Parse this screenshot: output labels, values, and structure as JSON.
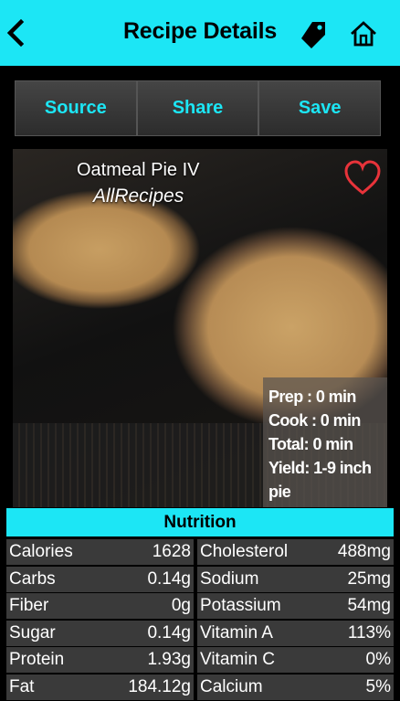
{
  "nav": {
    "title": "Recipe Details"
  },
  "tabs": [
    {
      "label": "Source"
    },
    {
      "label": "Share"
    },
    {
      "label": "Save"
    }
  ],
  "recipe": {
    "name": "Oatmeal Pie IV",
    "source": "AllRecipes",
    "prep": "Prep : 0 min",
    "cook": "Cook : 0 min",
    "total": "Total: 0 min",
    "yield": "Yield: 1-9 inch pie"
  },
  "nutrition": {
    "header": "Nutrition",
    "rows": [
      {
        "l_name": "Calories",
        "l_val": "1628",
        "r_name": "Cholesterol",
        "r_val": "488mg"
      },
      {
        "l_name": "Carbs",
        "l_val": "0.14g",
        "r_name": "Sodium",
        "r_val": "25mg"
      },
      {
        "l_name": "Fiber",
        "l_val": "0g",
        "r_name": "Potassium",
        "r_val": "54mg"
      },
      {
        "l_name": "Sugar",
        "l_val": "0.14g",
        "r_name": "Vitamin A",
        "r_val": "113%"
      },
      {
        "l_name": "Protein",
        "l_val": "1.93g",
        "r_name": "Vitamin C",
        "r_val": "0%"
      },
      {
        "l_name": "Fat",
        "l_val": "184.12g",
        "r_name": "Calcium",
        "r_val": "5%"
      }
    ]
  },
  "colors": {
    "accent": "#1ce6f5",
    "heart": "#e8333a"
  }
}
